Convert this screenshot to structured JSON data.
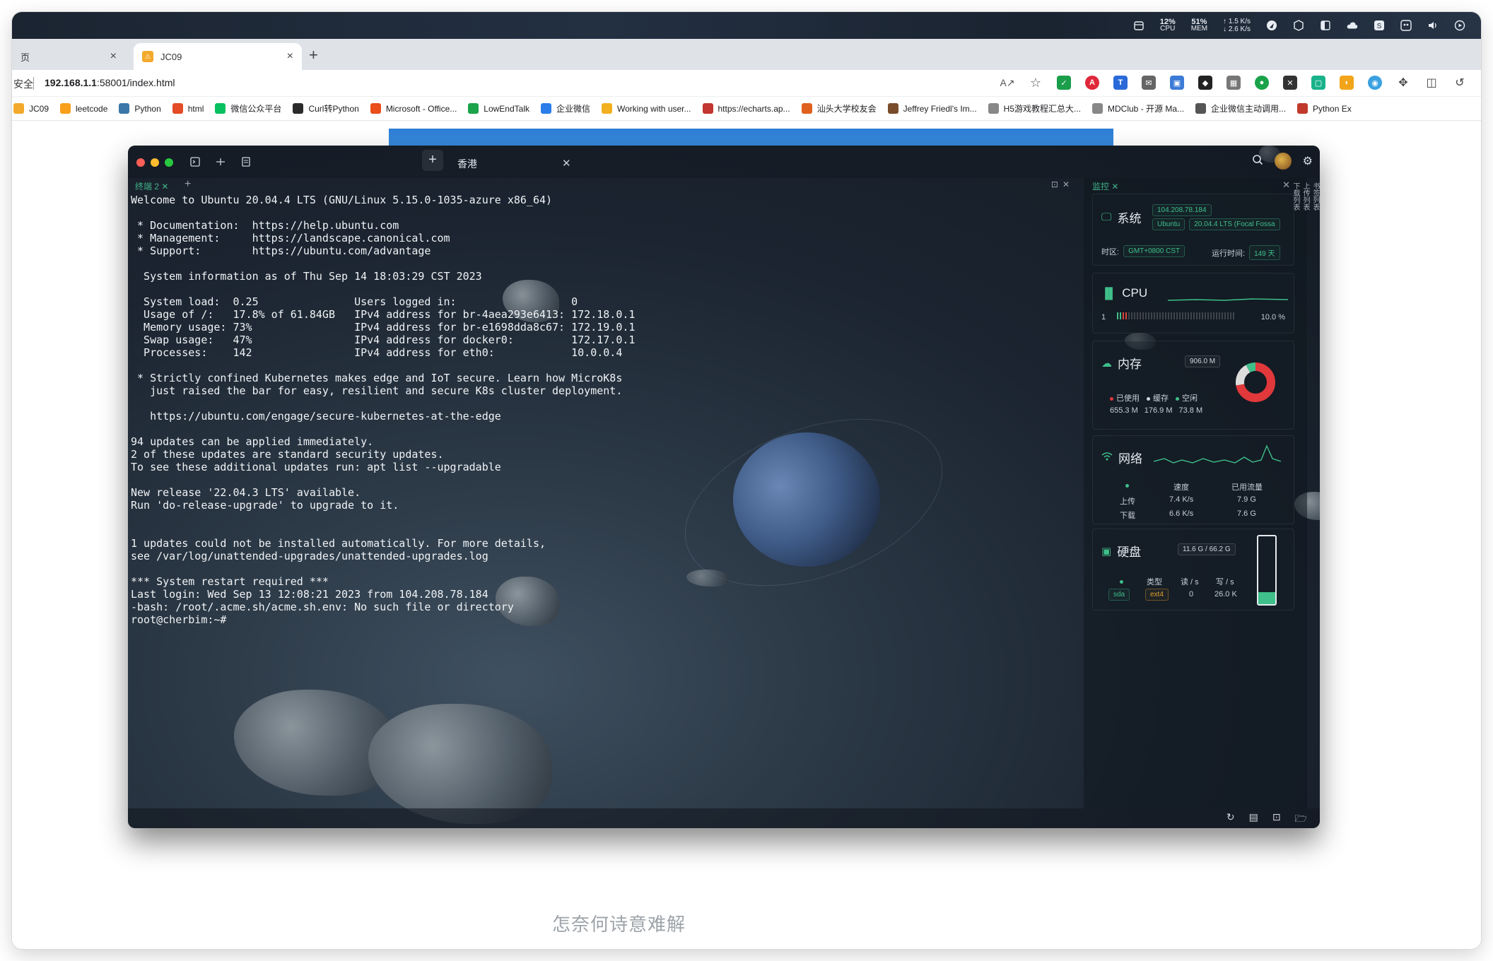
{
  "system_bar": {
    "cpu_pct": "12%",
    "cpu_label": "CPU",
    "mem_pct": "51%",
    "mem_label": "MEM",
    "net_up": "↑ 1.5 K/s",
    "net_down": "↓ 2.6 K/s"
  },
  "browser": {
    "inactive_tab_label": "页",
    "active_tab_label": "JC09",
    "new_tab": "+",
    "secure_label": "安全",
    "url_host": "192.168.1.1",
    "url_rest": ":58001/index.html",
    "bookmarks": [
      {
        "label": "JC09",
        "color": "#f3a92b"
      },
      {
        "label": "leetcode",
        "color": "#f89f1b"
      },
      {
        "label": "Python",
        "color": "#3b77a8"
      },
      {
        "label": "html",
        "color": "#e34c26"
      },
      {
        "label": "微信公众平台",
        "color": "#07c160"
      },
      {
        "label": "Curl转Python",
        "color": "#2b2b2b"
      },
      {
        "label": "Microsoft - Office...",
        "color": "#e94e1b"
      },
      {
        "label": "LowEndTalk",
        "color": "#1aa34a"
      },
      {
        "label": "企业微信",
        "color": "#2b7de9"
      },
      {
        "label": "Working with user...",
        "color": "#f2b01e"
      },
      {
        "label": "https://echarts.ap...",
        "color": "#c23531"
      },
      {
        "label": "汕头大学校友会",
        "color": "#e0601d"
      },
      {
        "label": "Jeffrey Friedl's Im...",
        "color": "#7a4b2a"
      },
      {
        "label": "H5游戏教程汇总大...",
        "color": "#888888"
      },
      {
        "label": "MDClub - 开源 Ma...",
        "color": "#888888"
      },
      {
        "label": "企业微信主动调用...",
        "color": "#555555"
      },
      {
        "label": "Python Ex",
        "color": "#c0392b"
      }
    ]
  },
  "app": {
    "session_tab": "香港",
    "terminal_tab": "终端 2",
    "monitor_tab": "监控",
    "vertical_tabs": [
      "书签列表",
      "上传列表",
      "下载列表"
    ],
    "terminal_lines": [
      "Welcome to Ubuntu 20.04.4 LTS (GNU/Linux 5.15.0-1035-azure x86_64)",
      "",
      " * Documentation:  https://help.ubuntu.com",
      " * Management:     https://landscape.canonical.com",
      " * Support:        https://ubuntu.com/advantage",
      "",
      "  System information as of Thu Sep 14 18:03:29 CST 2023",
      "",
      "  System load:  0.25               Users logged in:                  0",
      "  Usage of /:   17.8% of 61.84GB   IPv4 address for br-4aea293e6413: 172.18.0.1",
      "  Memory usage: 73%                IPv4 address for br-e1698dda8c67: 172.19.0.1",
      "  Swap usage:   47%                IPv4 address for docker0:         172.17.0.1",
      "  Processes:    142                IPv4 address for eth0:            10.0.0.4",
      "",
      " * Strictly confined Kubernetes makes edge and IoT secure. Learn how MicroK8s",
      "   just raised the bar for easy, resilient and secure K8s cluster deployment.",
      "",
      "   https://ubuntu.com/engage/secure-kubernetes-at-the-edge",
      "",
      "94 updates can be applied immediately.",
      "2 of these updates are standard security updates.",
      "To see these additional updates run: apt list --upgradable",
      "",
      "New release '22.04.3 LTS' available.",
      "Run 'do-release-upgrade' to upgrade to it.",
      "",
      "",
      "1 updates could not be installed automatically. For more details,",
      "see /var/log/unattended-upgrades/unattended-upgrades.log",
      "",
      "*** System restart required ***",
      "Last login: Wed Sep 13 12:08:21 2023 from 104.208.78.184",
      "-bash: /root/.acme.sh/acme.sh.env: No such file or directory",
      "root@cherbim:~#"
    ]
  },
  "monitor": {
    "system": {
      "title": "系统",
      "ip": "104.208.78.184",
      "os": "Ubuntu",
      "version": "20.04.4 LTS (Focal Fossa",
      "timezone_label": "时区:",
      "timezone": "GMT+0800   CST",
      "uptime_label": "运行时间:",
      "uptime": "149 天"
    },
    "cpu": {
      "title": "CPU",
      "cores": "1",
      "usage": "10.0 %",
      "usage_fraction": 0.1
    },
    "memory": {
      "title": "内存",
      "total": "906.0 M",
      "used_label": "已使用",
      "cache_label": "缓存",
      "free_label": "空闲",
      "used": "655.3 M",
      "cache": "176.9 M",
      "free": "73.8 M",
      "used_color": "#e0383b",
      "cache_color": "#3fbf8a",
      "free_color": "#dddddd"
    },
    "network": {
      "title": "网络",
      "speed_label": "速度",
      "total_label": "已用流量",
      "up_label": "上传",
      "down_label": "下载",
      "up_speed": "7.4 K/s",
      "down_speed": "6.6 K/s",
      "up_total": "7.9 G",
      "down_total": "7.6 G"
    },
    "disk": {
      "title": "硬盘",
      "usage": "11.6 G / 66.2 G",
      "usage_fraction": 0.175,
      "type_label": "类型",
      "read_label": "读 / s",
      "write_label": "写 / s",
      "device": "sda",
      "fs": "ext4",
      "read": "0",
      "write": "26.0 K"
    }
  },
  "page_caption": "怎奈何诗意难解",
  "colors": {
    "accent_green": "#3fbf8a",
    "accent_orange": "#e0a030"
  }
}
